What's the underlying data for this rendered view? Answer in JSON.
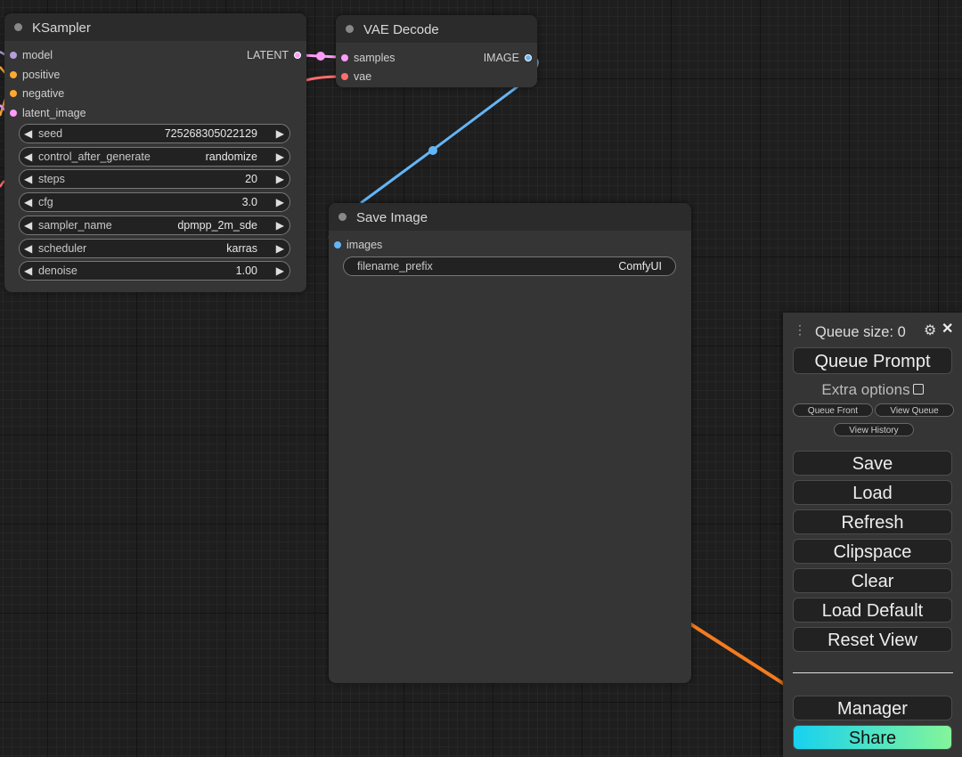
{
  "ksampler": {
    "title": "KSampler",
    "inputs": [
      "model",
      "positive",
      "negative",
      "latent_image"
    ],
    "output": "LATENT",
    "widgets": [
      {
        "label": "seed",
        "value": "725268305022129"
      },
      {
        "label": "control_after_generate",
        "value": "randomize"
      },
      {
        "label": "steps",
        "value": "20"
      },
      {
        "label": "cfg",
        "value": "3.0"
      },
      {
        "label": "sampler_name",
        "value": "dpmpp_2m_sde"
      },
      {
        "label": "scheduler",
        "value": "karras"
      },
      {
        "label": "denoise",
        "value": "1.00"
      }
    ]
  },
  "vae_decode": {
    "title": "VAE Decode",
    "inputs": [
      "samples",
      "vae"
    ],
    "output": "IMAGE"
  },
  "save_image": {
    "title": "Save Image",
    "input": "images",
    "widget": {
      "label": "filename_prefix",
      "value": "ComfyUI"
    }
  },
  "menu": {
    "queue_size": "Queue size: 0",
    "queue_prompt": "Queue Prompt",
    "extra_options": "Extra options",
    "queue_front": "Queue Front",
    "view_queue": "View Queue",
    "view_history": "View History",
    "buttons": [
      "Save",
      "Load",
      "Refresh",
      "Clipspace",
      "Clear",
      "Load Default",
      "Reset View"
    ],
    "manager": "Manager",
    "share": "Share"
  },
  "colors": {
    "model": "#b39ddb",
    "clip_conditioning": "#ffa931",
    "latent": "#ff9cf9",
    "vae": "#ff6e6e",
    "image": "#64b5f6",
    "annotation_arrow": "#f47b20"
  }
}
